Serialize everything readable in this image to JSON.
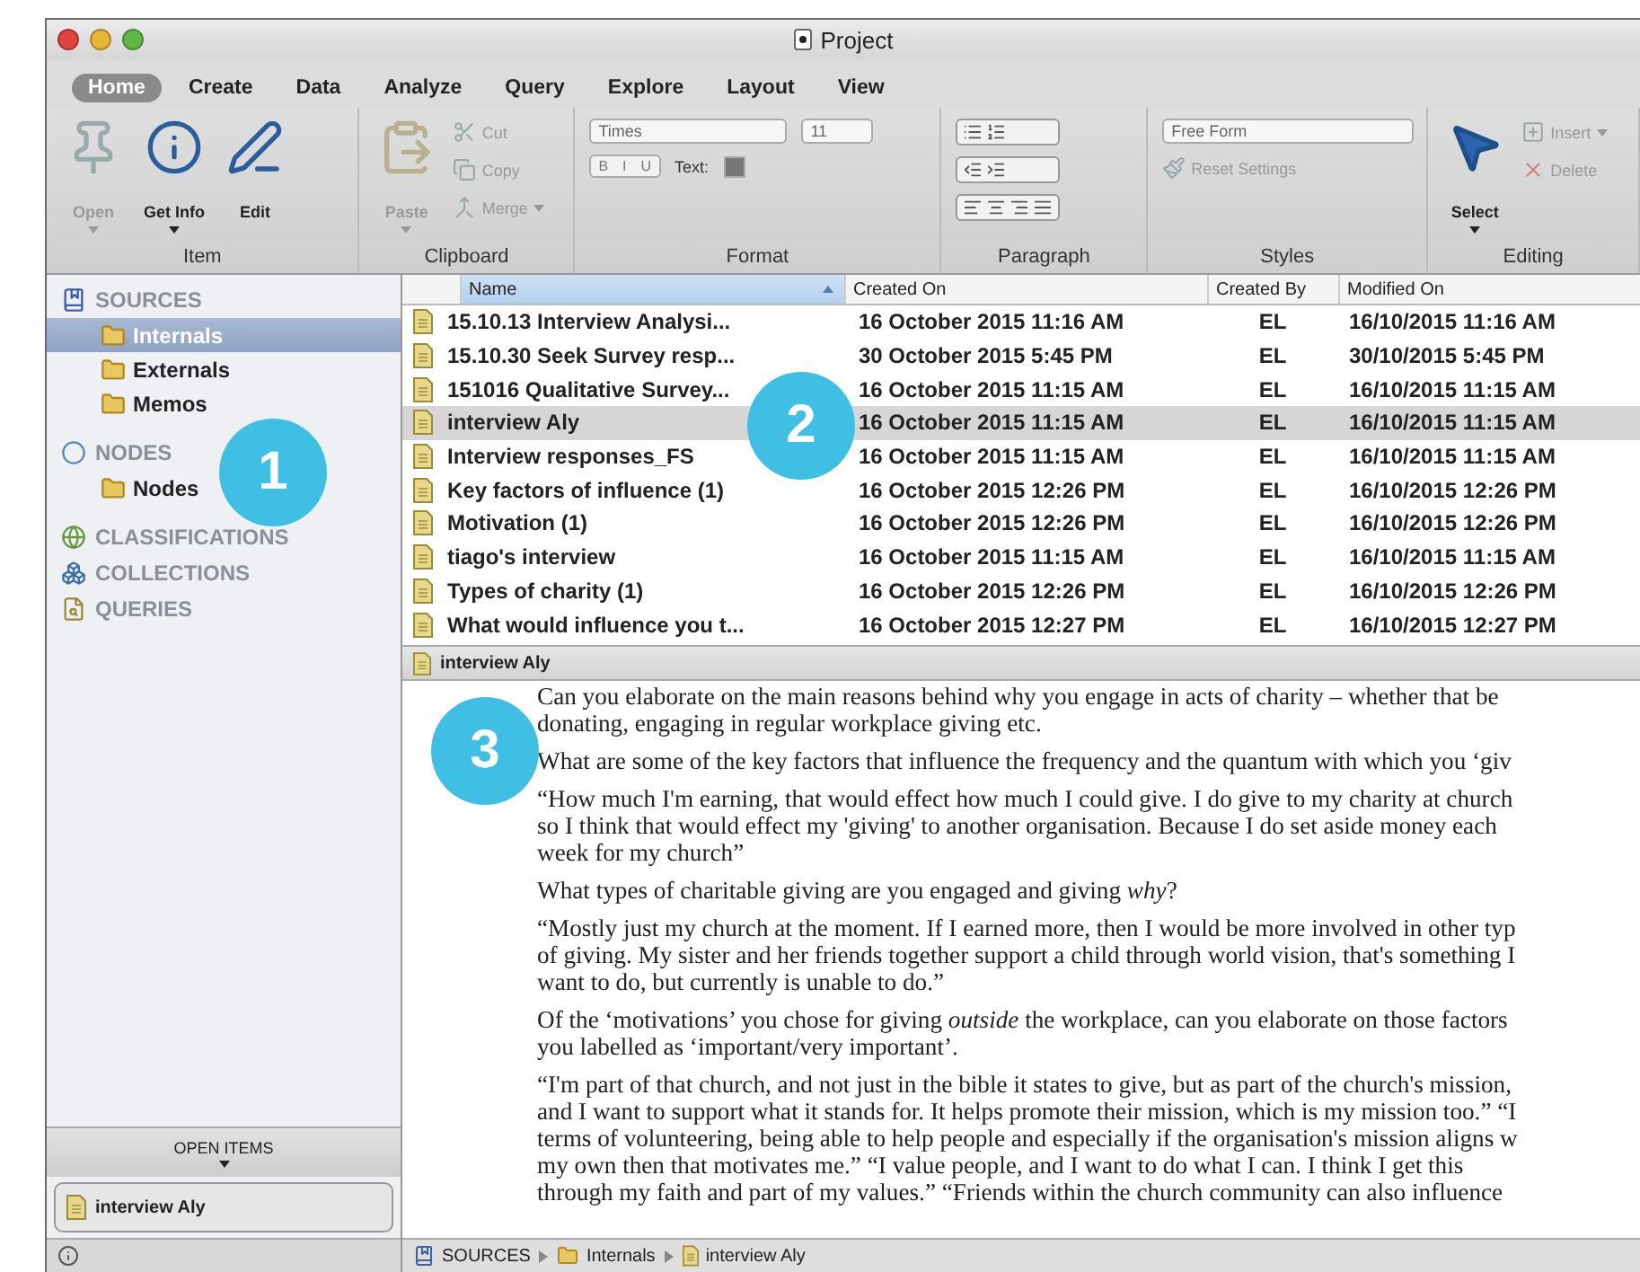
{
  "window": {
    "title": "Project"
  },
  "tabs": [
    {
      "label": "Home",
      "selected": true
    },
    {
      "label": "Create",
      "selected": false
    },
    {
      "label": "Data",
      "selected": false
    },
    {
      "label": "Analyze",
      "selected": false
    },
    {
      "label": "Query",
      "selected": false
    },
    {
      "label": "Explore",
      "selected": false
    },
    {
      "label": "Layout",
      "selected": false
    },
    {
      "label": "View",
      "selected": false
    }
  ],
  "ribbon": [
    {
      "kind": "item",
      "title": "Item",
      "items": [
        {
          "label": "Open",
          "disabled": true,
          "dropdown": true
        },
        {
          "label": "Get Info",
          "disabled": false,
          "dropdown": true
        },
        {
          "label": "Edit",
          "disabled": false,
          "dropdown": false
        }
      ]
    },
    {
      "kind": "clipboard",
      "title": "Clipboard",
      "large": {
        "label": "Paste",
        "disabled": true,
        "dropdown": true
      },
      "small": [
        {
          "label": "Cut",
          "disabled": true,
          "dropdown": false
        },
        {
          "label": "Copy",
          "disabled": true,
          "dropdown": false
        },
        {
          "label": "Merge",
          "disabled": true,
          "dropdown": true
        }
      ]
    },
    {
      "kind": "format",
      "title": "Format",
      "font": "Times",
      "size": "11",
      "styles": [
        "B",
        "I",
        "U"
      ],
      "color_label": "Text:"
    },
    {
      "kind": "paragraph",
      "title": "Paragraph"
    },
    {
      "kind": "styles",
      "title": "Styles",
      "style": "Free Form",
      "reset": {
        "label": "Reset Settings",
        "disabled": true
      }
    },
    {
      "kind": "editing",
      "title": "Editing",
      "select": {
        "label": "Select",
        "dropdown": true
      },
      "small": [
        {
          "label": "Insert",
          "disabled": true,
          "dropdown": true
        },
        {
          "label": "Delete",
          "disabled": true,
          "dropdown": false
        }
      ]
    }
  ],
  "sidebar": {
    "sections": [
      {
        "label": "SOURCES",
        "children": [
          {
            "label": "Internals",
            "selected": true
          },
          {
            "label": "Externals",
            "selected": false
          },
          {
            "label": "Memos",
            "selected": false
          }
        ]
      },
      {
        "label": "NODES",
        "children": [
          {
            "label": "Nodes",
            "selected": false
          }
        ]
      },
      {
        "label": "CLASSIFICATIONS"
      },
      {
        "label": "COLLECTIONS"
      },
      {
        "label": "QUERIES"
      }
    ],
    "open_items": {
      "label": "OPEN ITEMS",
      "items": [
        {
          "label": "interview Aly"
        }
      ]
    }
  },
  "table": {
    "columns": [
      {
        "label": "Name",
        "sorted": true
      },
      {
        "label": "Created On",
        "sorted": false
      },
      {
        "label": "Created By",
        "sorted": false
      },
      {
        "label": "Modified On",
        "sorted": false
      }
    ],
    "rows": [
      {
        "name": "15.10.13 Interview Analysi...",
        "created_on": "16 October 2015 11:16 AM",
        "created_by": "EL",
        "modified_on": "16/10/2015 11:16 AM",
        "selected": false
      },
      {
        "name": "15.10.30 Seek Survey resp...",
        "created_on": "30 October 2015 5:45 PM",
        "created_by": "EL",
        "modified_on": "30/10/2015 5:45 PM",
        "selected": false
      },
      {
        "name": "151016 Qualitative Survey...",
        "created_on": "16 October 2015 11:15 AM",
        "created_by": "EL",
        "modified_on": "16/10/2015 11:15 AM",
        "selected": false
      },
      {
        "name": "interview Aly",
        "created_on": "16 October 2015 11:15 AM",
        "created_by": "EL",
        "modified_on": "16/10/2015 11:15 AM",
        "selected": true
      },
      {
        "name": "Interview responses_FS",
        "created_on": "16 October 2015 11:15 AM",
        "created_by": "EL",
        "modified_on": "16/10/2015 11:15 AM",
        "selected": false
      },
      {
        "name": "Key factors of influence (1)",
        "created_on": "16 October 2015 12:26 PM",
        "created_by": "EL",
        "modified_on": "16/10/2015 12:26 PM",
        "selected": false
      },
      {
        "name": "Motivation (1)",
        "created_on": "16 October 2015 12:26 PM",
        "created_by": "EL",
        "modified_on": "16/10/2015 12:26 PM",
        "selected": false
      },
      {
        "name": "tiago's interview",
        "created_on": "16 October 2015 11:15 AM",
        "created_by": "EL",
        "modified_on": "16/10/2015 11:15 AM",
        "selected": false
      },
      {
        "name": "Types of charity (1)",
        "created_on": "16 October 2015 12:26 PM",
        "created_by": "EL",
        "modified_on": "16/10/2015 12:26 PM",
        "selected": false
      },
      {
        "name": "What would influence you t...",
        "created_on": "16 October 2015 12:27 PM",
        "created_by": "EL",
        "modified_on": "16/10/2015 12:27 PM",
        "selected": false
      }
    ]
  },
  "preview": {
    "title": "interview Aly"
  },
  "document": {
    "paragraphs": [
      {
        "lines": [
          "Can you elaborate on the main reasons behind why you engage in acts of charity – whether that be",
          "donating, engaging in regular workplace giving etc."
        ]
      },
      {
        "lines": [
          "What are some of the key factors that influence the frequency and the quantum with which you ‘giv"
        ]
      },
      {
        "lines": [
          "“How much I'm earning, that would effect how much I could give. I do give to my charity at church",
          "so I think that would effect my 'giving' to another organisation. Because I do set aside money each",
          "week for my church”"
        ]
      },
      {
        "lines": [
          "What types of charitable giving are you engaged and giving *why*?"
        ]
      },
      {
        "lines": [
          "“Mostly just my church at the moment. If I earned more, then I would be more involved in other typ",
          "of giving. My sister and her friends together support a child through world vision, that's something I",
          "want to do, but currently is unable to do.”"
        ]
      },
      {
        "lines": [
          "Of the ‘motivations’ you chose for giving *outside* the workplace, can you elaborate on those factors",
          "you labelled as ‘important/very important’."
        ]
      },
      {
        "lines": [
          "“I'm part of that church, and not just in the bible it states to give, but as part of the church's mission,",
          "and I want to support what it stands for. It helps promote their mission, which is my mission too.” “I",
          "terms of volunteering, being able to help people and especially if the organisation's mission aligns w",
          "my own then that motivates me.” “I value people, and I want to do what I can. I think I get this",
          "through my faith and part of my values.” “Friends within the church community can also influence"
        ]
      }
    ]
  },
  "breadcrumb": [
    "SOURCES",
    "Internals",
    "interview Aly"
  ],
  "callouts": [
    {
      "label": "1"
    },
    {
      "label": "2"
    },
    {
      "label": "3"
    }
  ]
}
